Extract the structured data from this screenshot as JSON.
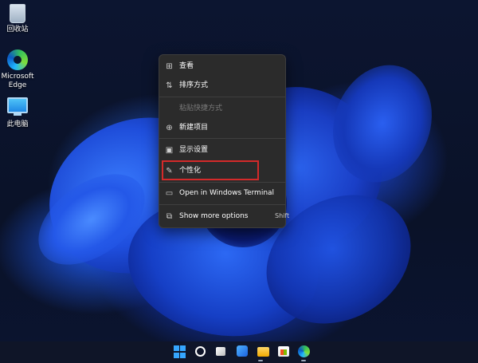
{
  "desktop": {
    "icons": [
      {
        "label": "回收站",
        "icon": "recycle-bin-icon"
      },
      {
        "label": "Microsoft Edge",
        "line1": "Microsoft",
        "line2": "Edge",
        "icon": "edge-icon"
      },
      {
        "label": "此电脑",
        "icon": "this-pc-icon"
      }
    ]
  },
  "context_menu": {
    "items": [
      {
        "label": "查看",
        "icon": "view-grid-icon",
        "enabled": true
      },
      {
        "label": "排序方式",
        "icon": "sort-icon",
        "enabled": true
      },
      {
        "label": "粘贴快捷方式",
        "icon": "",
        "enabled": false
      },
      {
        "label": "新建项目",
        "icon": "plus-circle-icon",
        "enabled": true
      },
      {
        "label": "显示设置",
        "icon": "display-icon",
        "enabled": true
      },
      {
        "label": "个性化",
        "icon": "pen-icon",
        "enabled": true,
        "highlighted": true
      },
      {
        "label": "Open in Windows Terminal",
        "icon": "terminal-icon",
        "enabled": true
      },
      {
        "label": "Show more options",
        "icon": "more-options-icon",
        "enabled": true,
        "shortcut": "Shift"
      }
    ],
    "highlight_color": "#d42a2a"
  },
  "taskbar": {
    "icons": [
      "start-icon",
      "search-icon",
      "task-view-icon",
      "widgets-icon",
      "file-explorer-icon",
      "store-icon",
      "edge-icon"
    ]
  }
}
